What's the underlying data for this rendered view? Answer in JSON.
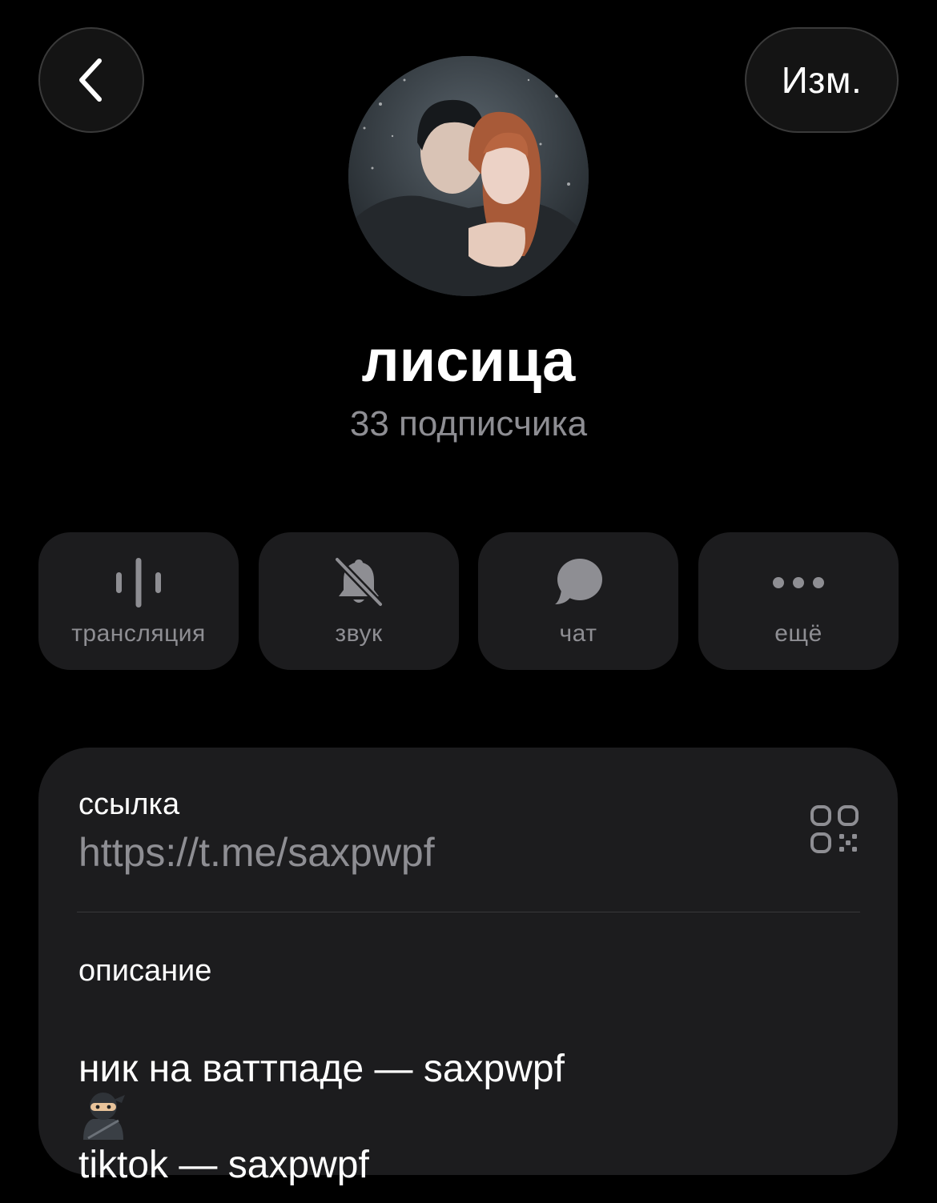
{
  "header": {
    "back_icon": "chevron-left-icon",
    "edit_label": "Изм."
  },
  "profile": {
    "name": "лисица",
    "subscribers": "33 подписчика"
  },
  "actions": [
    {
      "icon": "broadcast-waveform-icon",
      "label": "трансляция"
    },
    {
      "icon": "bell-muted-icon",
      "label": "звук"
    },
    {
      "icon": "chat-bubble-icon",
      "label": "чат"
    },
    {
      "icon": "more-dots-icon",
      "label": "ещё"
    }
  ],
  "info": {
    "link_label": "ссылка",
    "link_value": "https://t.me/saxpwpf",
    "qr_icon": "qr-code-icon",
    "description_label": "описание",
    "description_lines": [
      "ник на ваттпаде — saxpwpf",
      "tiktok — saxpwpf"
    ],
    "emoji_icon": "ninja-emoji-icon"
  },
  "colors": {
    "background": "#000000",
    "card": "#1c1c1e",
    "secondary_text": "#8e8e93",
    "icon_gray": "#8e8e93"
  }
}
